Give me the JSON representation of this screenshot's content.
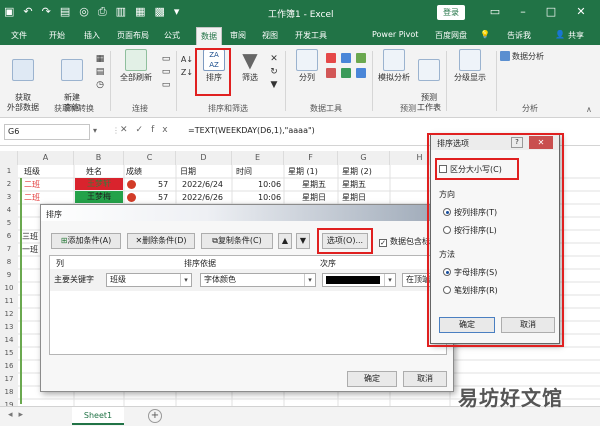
{
  "titlebar": {
    "qat_icons": [
      "save-icon",
      "undo-icon",
      "redo-icon",
      "paste-icon",
      "scan-icon",
      "print-preview-icon",
      "chart-icon",
      "table-icon",
      "grid-icon",
      "quick-access-dropdown-icon"
    ],
    "title": "工作簿1 - Excel",
    "login": "登录"
  },
  "ribbon_tabs": [
    "文件",
    "开始",
    "插入",
    "页面布局",
    "公式",
    "数据",
    "审阅",
    "视图",
    "开发工具",
    "Power Pivot",
    "百度网盘",
    "告诉我",
    "共享"
  ],
  "ribbon": {
    "get_data": "获取\n外部数据",
    "new_query": "新建\n查询",
    "refresh_all": "全部刷新",
    "group_get_transform": "获取和转换",
    "group_connections": "连接",
    "sort": "排序",
    "filter": "筛选",
    "group_sort_filter": "排序和筛选",
    "text_to_columns": "分列",
    "group_data_tools": "数据工具",
    "what_if": "模拟分析",
    "forecast_sheet": "预测\n工作表",
    "group_forecast": "预测",
    "outline": "分级显示",
    "data_analysis": "数据分析",
    "group_analysis": "分析"
  },
  "formula_bar": {
    "name_box": "G6",
    "formula": "=TEXT(WEEKDAY(D6,1),\"aaaa\")"
  },
  "sheet": {
    "columns": [
      "A",
      "B",
      "C",
      "D",
      "E",
      "F",
      "G",
      "H"
    ],
    "row_numbers": [
      "1",
      "2",
      "3",
      "4",
      "5",
      "6",
      "7",
      "8",
      "9",
      "10",
      "11",
      "12",
      "13",
      "14",
      "15",
      "16",
      "17",
      "18",
      "19"
    ],
    "header": [
      "班级",
      "姓名",
      "成绩",
      "日期",
      "时间",
      "星期 (1)",
      "星期 (2)"
    ],
    "rows": [
      [
        "二班",
        "王梦轩",
        "57",
        "2022/6/24",
        "10:06",
        "星期五",
        "星期五"
      ],
      [
        "二班",
        "王梦梅",
        "57",
        "2022/6/26",
        "10:06",
        "星期日",
        "星期日"
      ]
    ],
    "partial_labels": [
      "三班",
      "一班"
    ],
    "tab": "Sheet1"
  },
  "sort_dialog": {
    "title": "排序",
    "add_level": "添加条件(A)",
    "delete_level": "删除条件(D)",
    "copy_level": "复制条件(C)",
    "options": "选项(O)...",
    "header_checkbox": "数据包含标题(H)",
    "col_header": "列",
    "sorton_header": "排序依据",
    "order_header": "次序",
    "primary_key": "主要关键字",
    "column_value": "班级",
    "sorton_value": "字体颜色",
    "order_position": "在顶端",
    "ok": "确定",
    "cancel": "取消"
  },
  "options_dialog": {
    "title": "排序选项",
    "help": "?",
    "case_sensitive": "区分大小写(C)",
    "direction_label": "方向",
    "by_rows": "按列排序(T)",
    "by_cols": "按行排序(L)",
    "method_label": "方法",
    "by_letter": "字母排序(S)",
    "by_stroke": "笔划排序(R)",
    "ok": "确定",
    "cancel": "取消"
  },
  "watermark": "易坊好文馆",
  "colors": {
    "excel_green": "#217346",
    "highlight_red": "#e02020",
    "cell_red": "#d9232d",
    "cell_green": "#24a24a",
    "class_red_text": "#e23a3a"
  }
}
